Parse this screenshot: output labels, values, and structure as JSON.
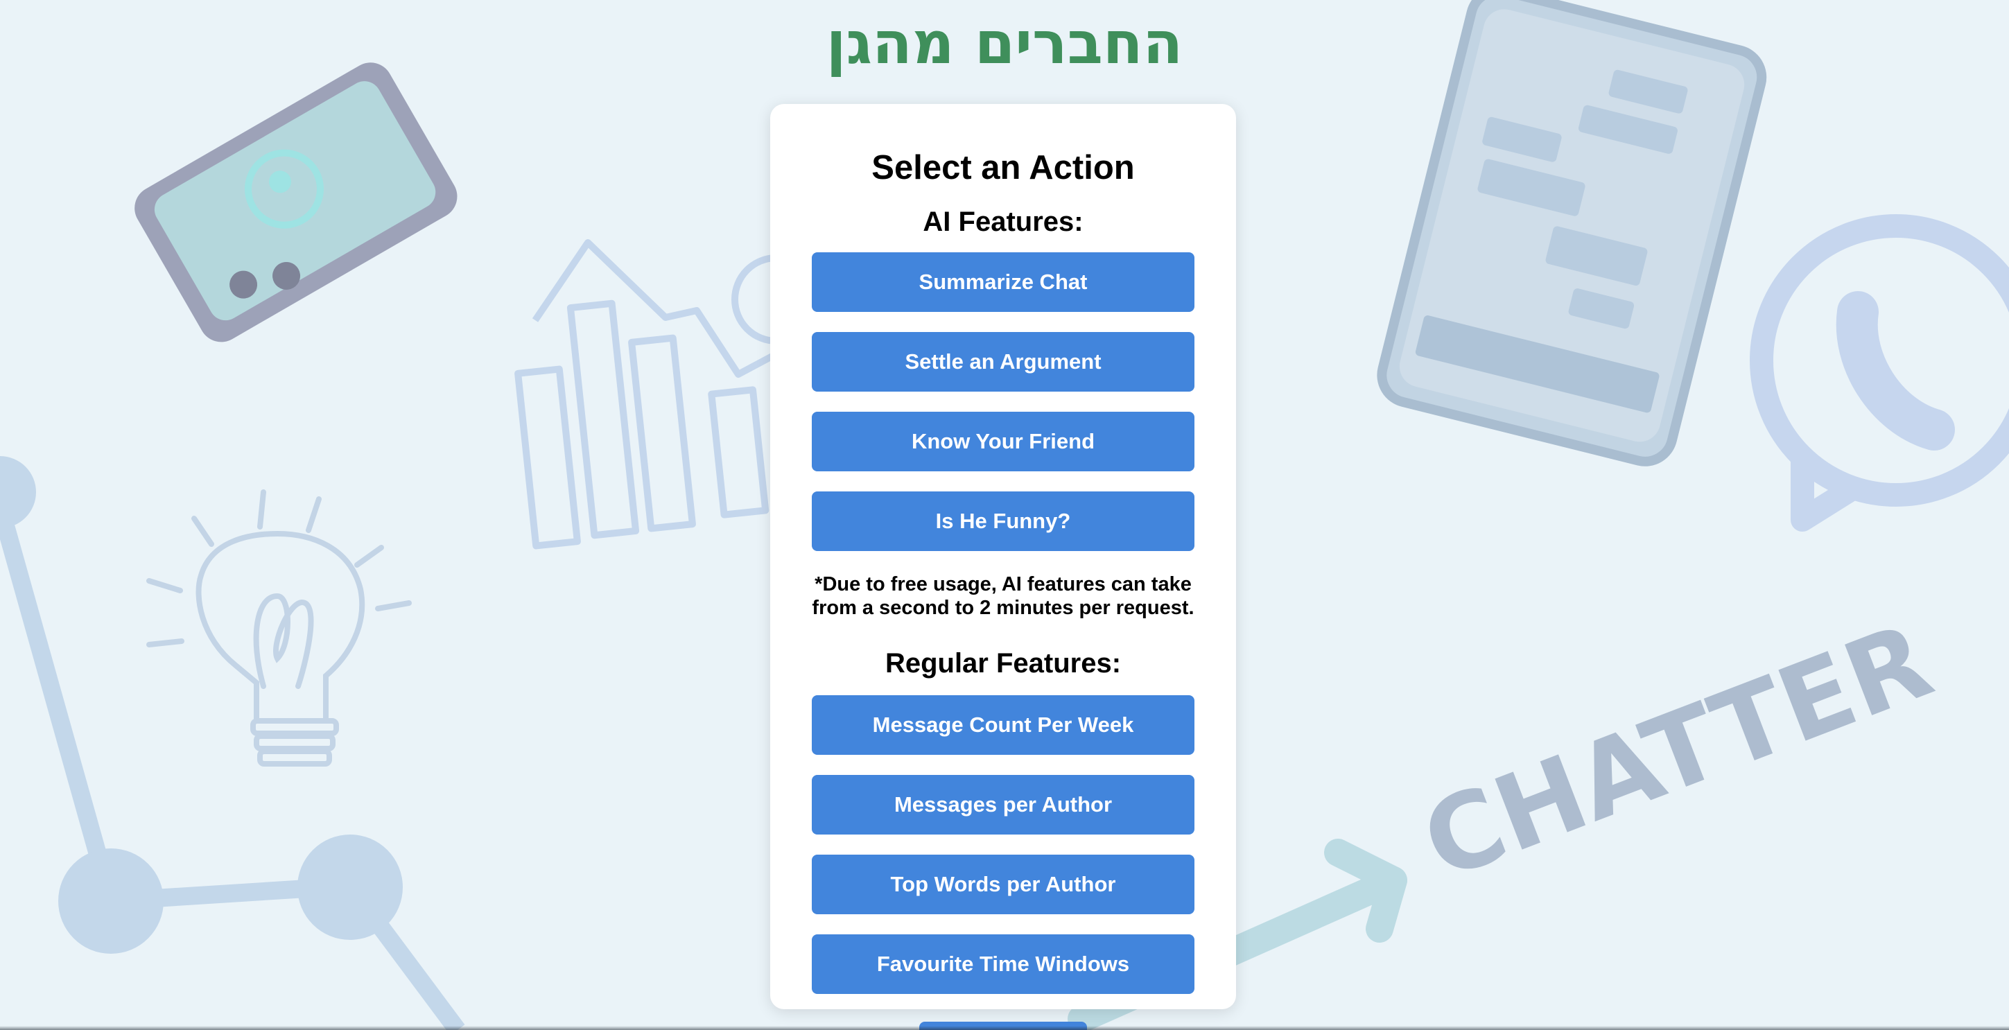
{
  "page": {
    "title": "החברים מהגן"
  },
  "card": {
    "heading": "Select an Action",
    "ai_section": {
      "heading": "AI Features:",
      "buttons": [
        "Summarize Chat",
        "Settle an Argument",
        "Know Your Friend",
        "Is He Funny?"
      ],
      "note": "*Due to free usage, AI features can take from a second to 2 minutes per request."
    },
    "regular_section": {
      "heading": "Regular Features:",
      "buttons": [
        "Message Count Per Week",
        "Messages per Author",
        "Top Words per Author",
        "Favourite Time Windows"
      ]
    }
  },
  "background": {
    "text": "CHATTER",
    "icons": [
      "phone-device-icon",
      "smartphone-chat-icon",
      "bar-chart-icon",
      "lightbulb-icon",
      "whatsapp-icon",
      "network-graph-icon",
      "arrow-icon"
    ]
  },
  "colors": {
    "title": "#3f8f5b",
    "button": "#4285dc",
    "background": "#eaf3f8",
    "illustration": "#b9cde3"
  }
}
